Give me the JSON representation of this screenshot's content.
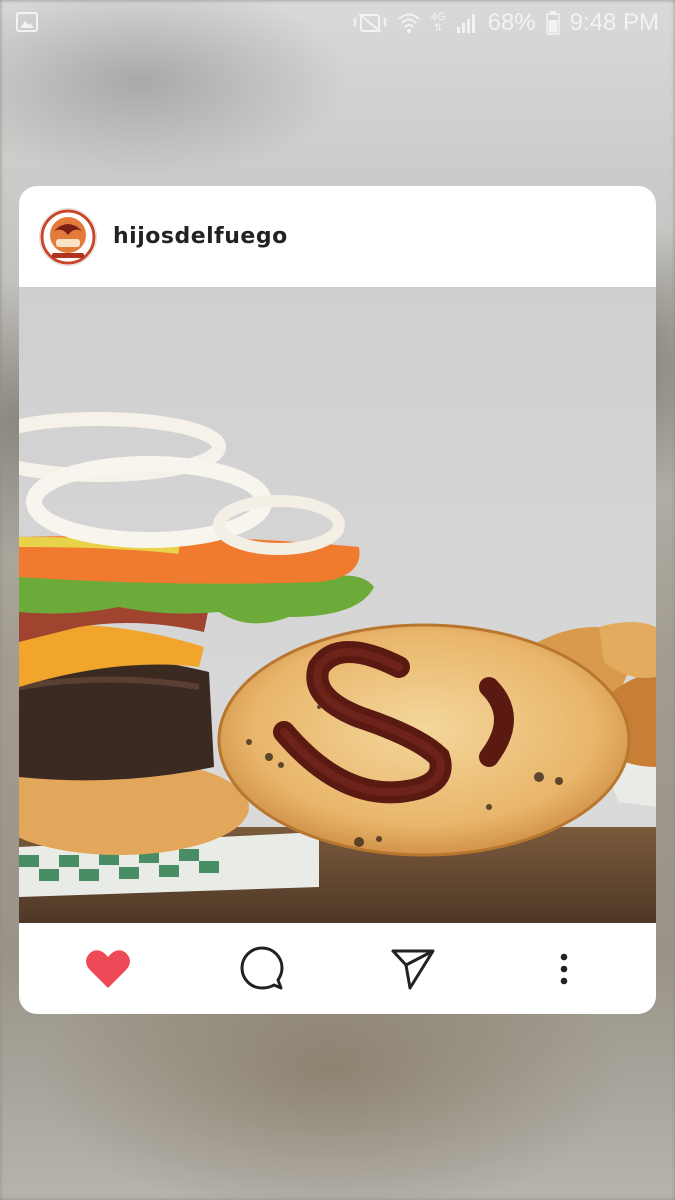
{
  "status_bar": {
    "battery": "68%",
    "time": "9:48 PM",
    "network": "4G",
    "icons": [
      "gallery-icon",
      "mute-icon",
      "wifi-icon",
      "signal-icon",
      "battery-icon"
    ]
  },
  "post": {
    "username": "hijosdelfuego",
    "avatar_icon": "profile-avatar",
    "photo_subject": "burger",
    "actions": {
      "like": "heart-icon",
      "comment": "comment-icon",
      "share": "send-icon",
      "more": "more-icon"
    },
    "liked": true,
    "like_color": "#ed4956"
  }
}
